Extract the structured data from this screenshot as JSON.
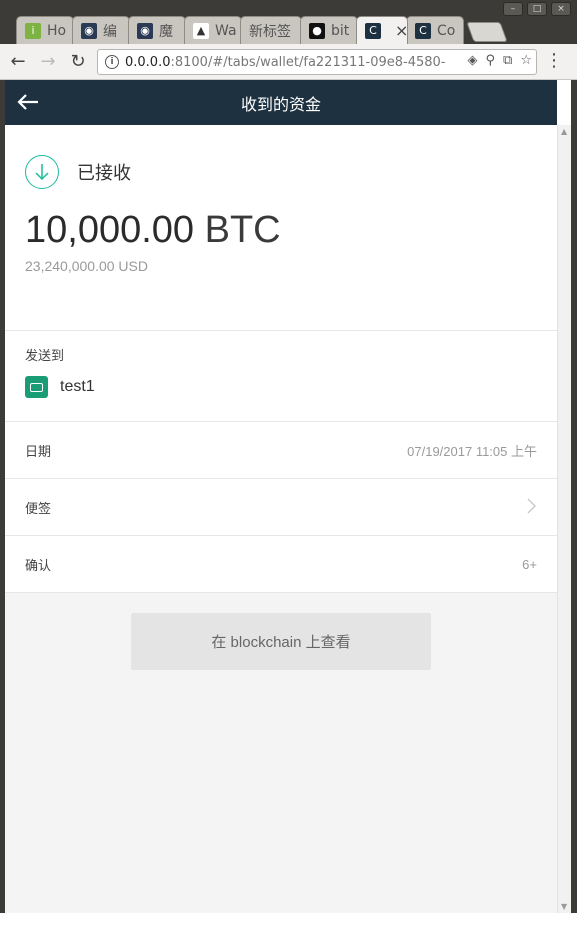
{
  "browser": {
    "tabs": [
      {
        "label": "Ho",
        "fav_color": "#7cb342",
        "fav_glyph": "i"
      },
      {
        "label": "编",
        "fav_color": "#2a3a55",
        "fav_glyph": "◉"
      },
      {
        "label": "魔",
        "fav_color": "#2a3a55",
        "fav_glyph": "◉"
      },
      {
        "label": "Wa",
        "fav_color": "#333333",
        "fav_glyph": "▲"
      },
      {
        "label": "新标签",
        "fav_color": "",
        "fav_glyph": ""
      },
      {
        "label": "bit",
        "fav_color": "#111111",
        "fav_glyph": "●"
      },
      {
        "label": "",
        "fav_color": "#1e3140",
        "fav_glyph": "C",
        "active": true
      },
      {
        "label": "Co",
        "fav_color": "#1e3140",
        "fav_glyph": "C"
      }
    ],
    "active_tab_close": "×",
    "url_host": "0.0.0.0",
    "url_rest": ":8100/#/tabs/wallet/fa221311-09e8-4580-"
  },
  "app": {
    "title": "收到的资金",
    "status": {
      "label": "已接收",
      "icon": "arrow-down-circle-icon",
      "color": "#1abc9c"
    },
    "amount": {
      "value": "10,000.00",
      "unit": "BTC"
    },
    "alt_amount": "23,240,000.00 USD",
    "sent_to": {
      "label": "发送到",
      "wallet_name": "test1",
      "wallet_color": "#1a9d75"
    },
    "rows": [
      {
        "label": "日期",
        "value": "07/19/2017 11:05 上午"
      },
      {
        "label": "便签",
        "value": ""
      },
      {
        "label": "确认",
        "value": "6+"
      }
    ],
    "explorer_button": "在 blockchain 上查看",
    "header_color": "#1e3140"
  }
}
